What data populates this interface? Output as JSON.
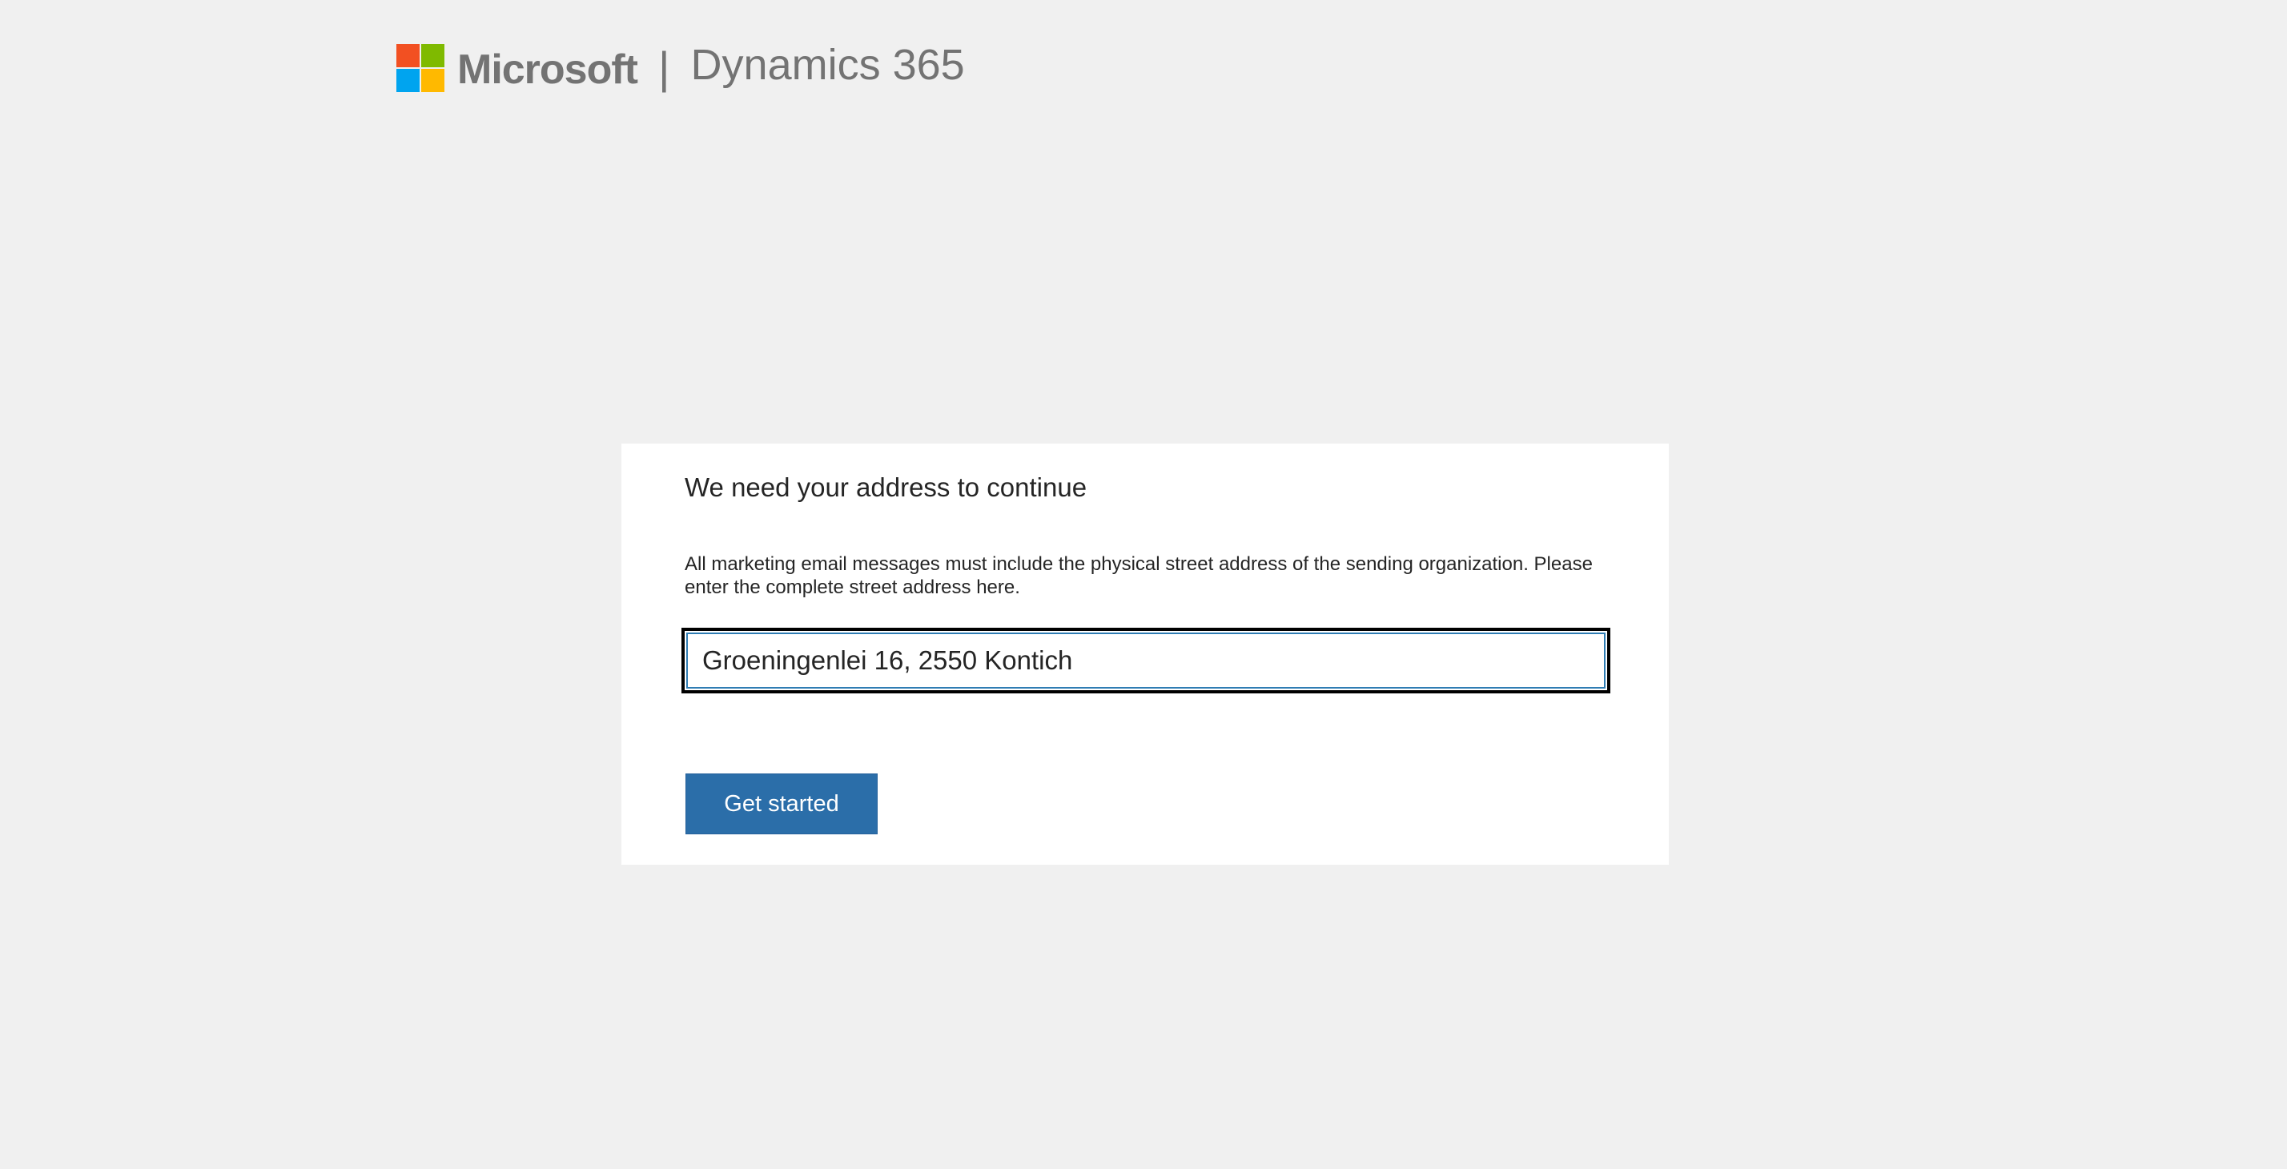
{
  "header": {
    "brand": "Microsoft",
    "separator": "|",
    "product": "Dynamics 365",
    "logo_colors": [
      "#f25022",
      "#7fba00",
      "#00a4ef",
      "#ffb900"
    ]
  },
  "dialog": {
    "title": "We need your address to continue",
    "description": "All marketing email messages must include the physical street address of the sending organization. Please enter the complete street address here.",
    "address_value": "Groeningenlei 16, 2550 Kontich",
    "submit_label": "Get started"
  },
  "colors": {
    "page_background": "#f0f0f0",
    "card_background": "#ffffff",
    "button_background": "#2b6ea9",
    "input_focus_border": "#2e7cb3",
    "logo_text": "#737373"
  }
}
